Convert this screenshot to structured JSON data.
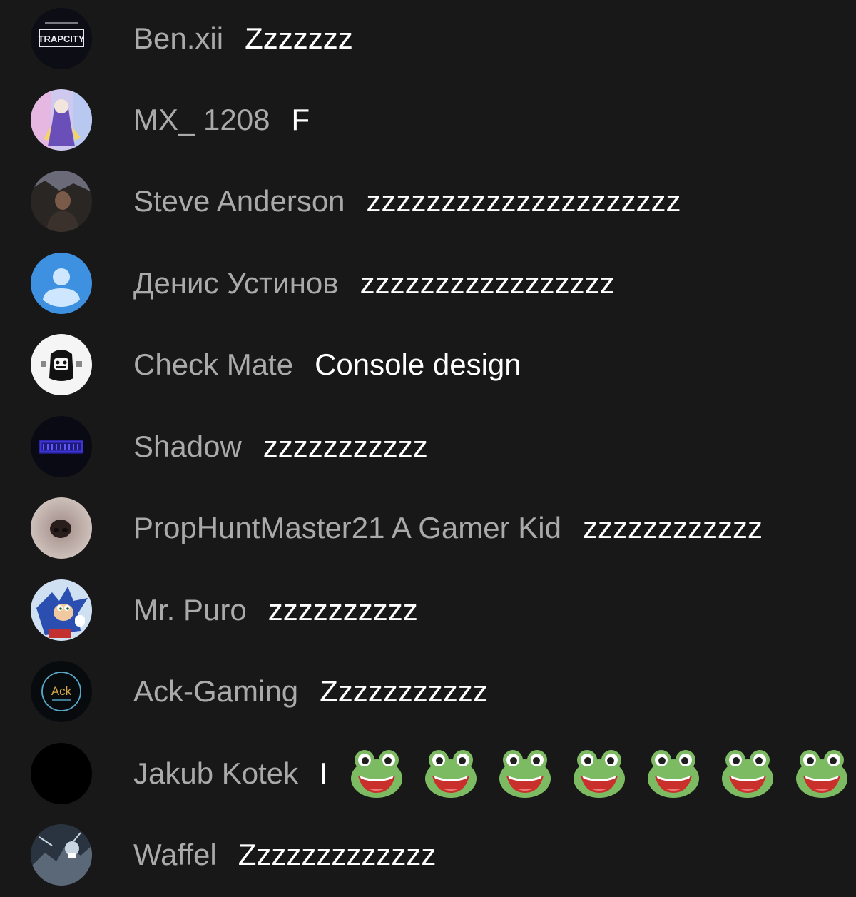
{
  "messages": [
    {
      "author": "Ben.xii",
      "text": "Zzzzzzz",
      "avatar": {
        "icon": "trapcity-logo-avatar",
        "label": "TRAPCITY",
        "bg": "#0d0d16",
        "accent": "#e8e8ee"
      }
    },
    {
      "author": "MX_ 1208",
      "text": "F",
      "avatar": {
        "icon": "anime-character-avatar",
        "bg": "#cfc8ef",
        "accent": "#6b4fb8"
      }
    },
    {
      "author": "Steve Anderson",
      "text": "zzzzzzzzzzzzzzzzzzzzz",
      "avatar": {
        "icon": "photo-person-avatar",
        "bg": "#2a2624",
        "accent": "#6a6a78"
      }
    },
    {
      "author": "Денис Устинов",
      "text": "zzzzzzzzzzzzzzzzz",
      "avatar": {
        "icon": "default-user-avatar",
        "bg": "#3e90e1",
        "accent": "#cfe6ff"
      }
    },
    {
      "author": "Check Mate",
      "text": "Console design",
      "avatar": {
        "icon": "cartoon-face-avatar",
        "bg": "#f5f5f5",
        "accent": "#111111"
      }
    },
    {
      "author": "Shadow",
      "text": "zzzzzzzzzzz",
      "avatar": {
        "icon": "neon-logo-avatar",
        "bg": "#0a0a14",
        "accent": "#3d35d8"
      }
    },
    {
      "author": "PropHuntMaster21 A Gamer Kid",
      "text": "zzzzzzzzzzzz",
      "avatar": {
        "icon": "dog-nose-avatar",
        "bg": "#b8a8a2",
        "accent": "#2a1e1c"
      }
    },
    {
      "author": "Mr. Puro",
      "text": "zzzzzzzzzz",
      "avatar": {
        "icon": "sonic-character-avatar",
        "bg": "#cfe0f2",
        "accent": "#2b4fb0"
      }
    },
    {
      "author": "Ack-Gaming",
      "text": "Zzzzzzzzzzz",
      "avatar": {
        "icon": "ack-gaming-logo-avatar",
        "label": "Ack",
        "bg": "#080b0e",
        "accent": "#5aa9c8"
      }
    },
    {
      "author": "Jakub Kotek",
      "text": "I",
      "emoji": [
        "frog-emoji",
        "frog-emoji",
        "frog-emoji",
        "frog-emoji",
        "frog-emoji",
        "frog-emoji",
        "frog-emoji"
      ],
      "avatar": {
        "icon": "black-avatar",
        "bg": "#000000",
        "accent": "#000000"
      }
    },
    {
      "author": "Waffel",
      "text": "Zzzzzzzzzzzzz",
      "avatar": {
        "icon": "space-art-avatar",
        "bg": "#2a3440",
        "accent": "#c8d4e0"
      }
    }
  ],
  "colors": {
    "background": "#181818",
    "author": "#aaaaaa",
    "text": "#ffffff",
    "frog_body": "#7dbb63",
    "frog_mouth": "#c9302c"
  }
}
